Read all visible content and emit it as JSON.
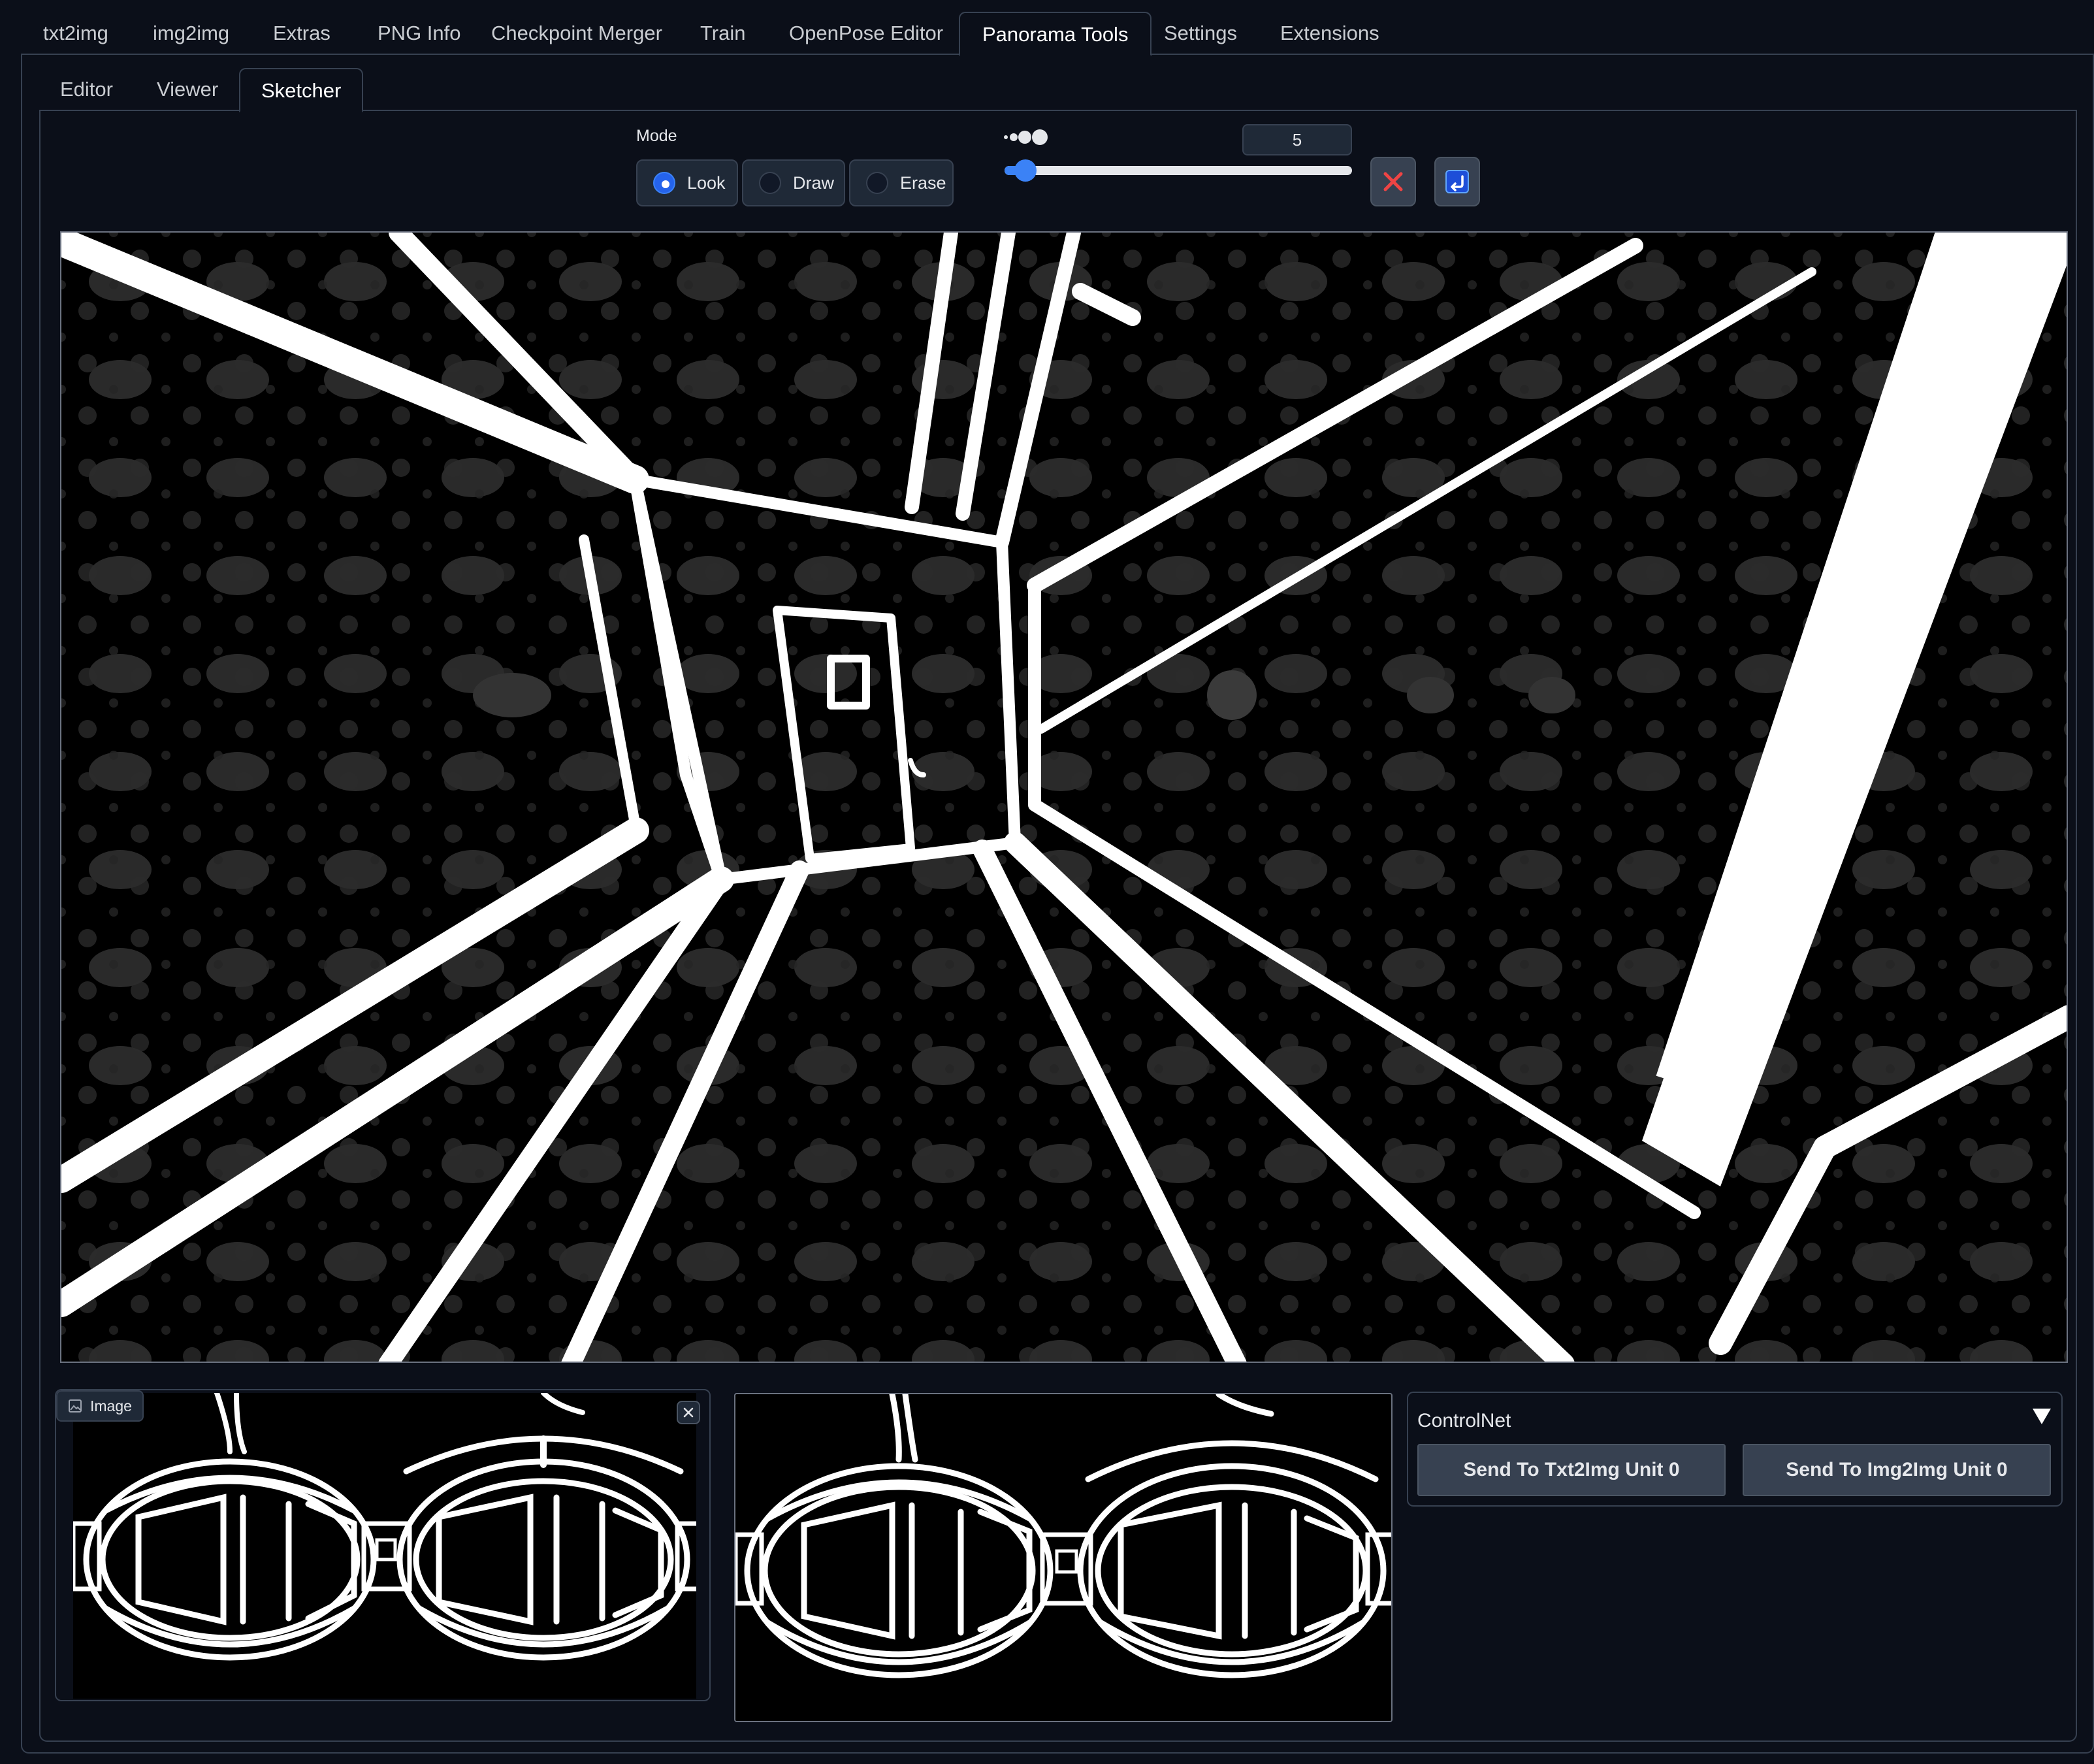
{
  "top_tabs": [
    "txt2img",
    "img2img",
    "Extras",
    "PNG Info",
    "Checkpoint Merger",
    "Train",
    "OpenPose Editor",
    "Panorama Tools",
    "Settings",
    "Extensions"
  ],
  "top_tabs_active": "Panorama Tools",
  "sub_tabs": [
    "Editor",
    "Viewer",
    "Sketcher"
  ],
  "sub_tabs_active": "Sketcher",
  "mode": {
    "label": "Mode",
    "options": [
      "Look",
      "Draw",
      "Erase"
    ],
    "selected": "Look"
  },
  "brush": {
    "value": "5",
    "slider_fraction": 0.06
  },
  "buttons": {
    "clear_icon": "red-x-icon",
    "undo_icon": "undo-icon"
  },
  "image_component": {
    "label": "Image"
  },
  "controlnet": {
    "title": "ControlNet",
    "send_txt2img": "Send To Txt2Img Unit 0",
    "send_img2img": "Send To Img2Img Unit 0"
  },
  "colors": {
    "background": "#0b0f19",
    "border": "#374151",
    "accent": "#3b82f6",
    "clear_red": "#ef4444"
  }
}
